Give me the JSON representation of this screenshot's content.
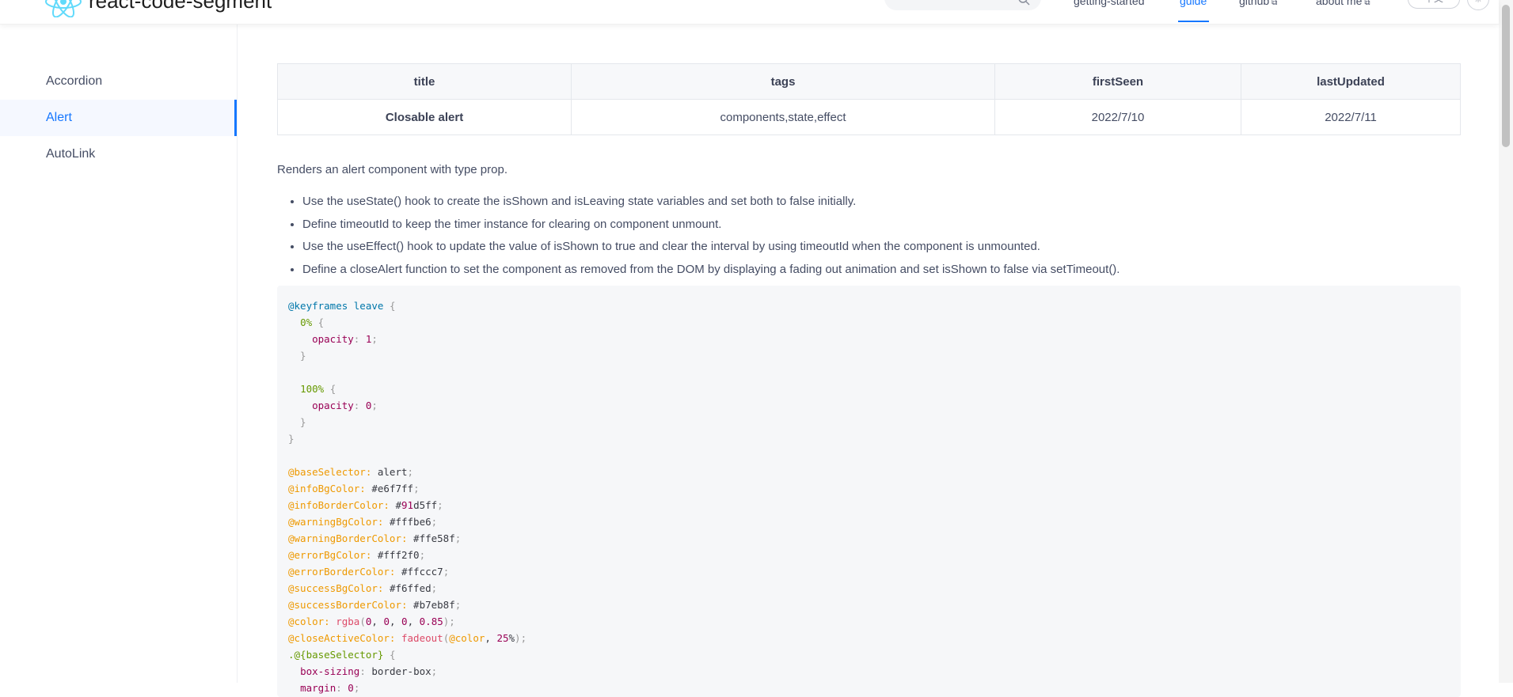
{
  "header": {
    "site_title": "react-code-segment",
    "nav": [
      {
        "label": "getting-started",
        "active": false
      },
      {
        "label": "guide",
        "active": true
      },
      {
        "label": "github",
        "active": false,
        "external": true
      },
      {
        "label": "about me",
        "active": false,
        "external": true
      }
    ],
    "lang_label": "中文",
    "theme_icon": "☀",
    "accent_color": "#1677ff"
  },
  "sidebar": {
    "items": [
      {
        "label": "Accordion",
        "active": false
      },
      {
        "label": "Alert",
        "active": true
      },
      {
        "label": "AutoLink",
        "active": false
      }
    ]
  },
  "meta_table": {
    "headers": [
      "title",
      "tags",
      "firstSeen",
      "lastUpdated"
    ],
    "row": [
      "Closable alert",
      "components,state,effect",
      "2022/7/10",
      "2022/7/11"
    ]
  },
  "description": "Renders an alert component with type prop.",
  "steps": [
    "Use the useState() hook to create the isShown and isLeaving state variables and set both to false initially.",
    "Define timeoutId to keep the timer instance for clearing on component unmount.",
    "Use the useEffect() hook to update the value of isShown to true and clear the interval by using timeoutId when the component is unmounted.",
    "Define a closeAlert function to set the component as removed from the DOM by displaying a fading out animation and set isShown to false via setTimeout()."
  ],
  "code_lines": [
    "@keyframes leave {",
    "  0% {",
    "    opacity: 1;",
    "  }",
    "",
    "  100% {",
    "    opacity: 0;",
    "  }",
    "}",
    "",
    "@baseSelector: alert;",
    "@infoBgColor: #e6f7ff;",
    "@infoBorderColor: #91d5ff;",
    "@warningBgColor: #fffbe6;",
    "@warningBorderColor: #ffe58f;",
    "@errorBgColor: #fff2f0;",
    "@errorBorderColor: #ffccc7;",
    "@successBgColor: #f6ffed;",
    "@successBorderColor: #b7eb8f;",
    "@color: rgba(0, 0, 0, 0.85);",
    "@closeActiveColor: fadeout(@color, 25%);",
    ".@{baseSelector} {",
    "  box-sizing: border-box;",
    "  margin: 0;"
  ]
}
